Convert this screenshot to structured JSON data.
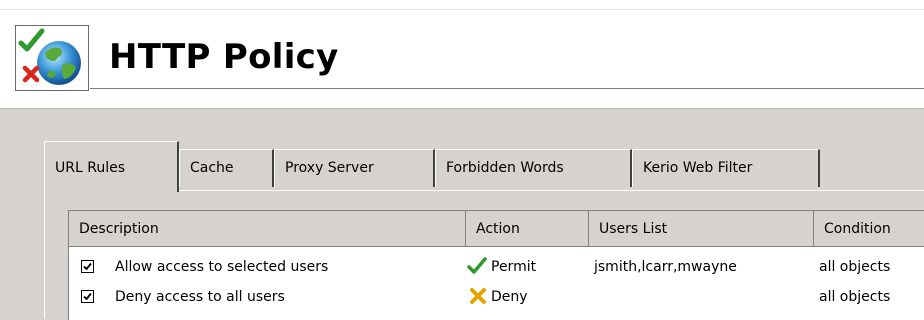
{
  "page": {
    "title": "HTTP Policy",
    "logo_icon": "globe-policy-icon"
  },
  "tabs": [
    {
      "label": "URL Rules",
      "active": true
    },
    {
      "label": "Cache",
      "active": false
    },
    {
      "label": "Proxy Server",
      "active": false
    },
    {
      "label": "Forbidden Words",
      "active": false
    },
    {
      "label": "Kerio Web Filter",
      "active": false
    }
  ],
  "table": {
    "columns": [
      "Description",
      "Action",
      "Users List",
      "Condition"
    ],
    "rows": [
      {
        "checked": true,
        "description": "Allow access to selected users",
        "action": "Permit",
        "action_icon": "green-check-icon",
        "users": "jsmith,lcarr,mwayne",
        "condition": "all objects"
      },
      {
        "checked": true,
        "description": "Deny access to all users",
        "action": "Deny",
        "action_icon": "yellow-x-icon",
        "users": "",
        "condition": "all objects"
      }
    ]
  },
  "colors": {
    "window_bg": "#d6d3ce",
    "permit": "#2e9a2e",
    "deny": "#e3a400"
  }
}
